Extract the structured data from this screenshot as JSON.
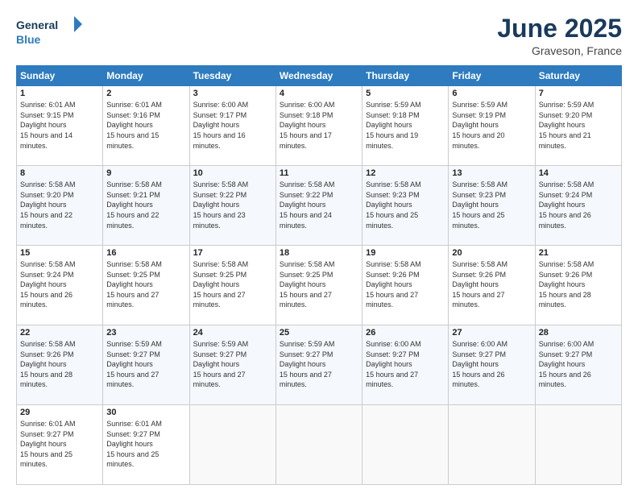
{
  "header": {
    "logo_general": "General",
    "logo_blue": "Blue",
    "month_title": "June 2025",
    "location": "Graveson, France"
  },
  "days_of_week": [
    "Sunday",
    "Monday",
    "Tuesday",
    "Wednesday",
    "Thursday",
    "Friday",
    "Saturday"
  ],
  "weeks": [
    [
      {
        "day": 1,
        "sunrise": "6:01 AM",
        "sunset": "9:15 PM",
        "daylight": "15 hours and 14 minutes."
      },
      {
        "day": 2,
        "sunrise": "6:01 AM",
        "sunset": "9:16 PM",
        "daylight": "15 hours and 15 minutes."
      },
      {
        "day": 3,
        "sunrise": "6:00 AM",
        "sunset": "9:17 PM",
        "daylight": "15 hours and 16 minutes."
      },
      {
        "day": 4,
        "sunrise": "6:00 AM",
        "sunset": "9:18 PM",
        "daylight": "15 hours and 17 minutes."
      },
      {
        "day": 5,
        "sunrise": "5:59 AM",
        "sunset": "9:18 PM",
        "daylight": "15 hours and 19 minutes."
      },
      {
        "day": 6,
        "sunrise": "5:59 AM",
        "sunset": "9:19 PM",
        "daylight": "15 hours and 20 minutes."
      },
      {
        "day": 7,
        "sunrise": "5:59 AM",
        "sunset": "9:20 PM",
        "daylight": "15 hours and 21 minutes."
      }
    ],
    [
      {
        "day": 8,
        "sunrise": "5:58 AM",
        "sunset": "9:20 PM",
        "daylight": "15 hours and 22 minutes."
      },
      {
        "day": 9,
        "sunrise": "5:58 AM",
        "sunset": "9:21 PM",
        "daylight": "15 hours and 22 minutes."
      },
      {
        "day": 10,
        "sunrise": "5:58 AM",
        "sunset": "9:22 PM",
        "daylight": "15 hours and 23 minutes."
      },
      {
        "day": 11,
        "sunrise": "5:58 AM",
        "sunset": "9:22 PM",
        "daylight": "15 hours and 24 minutes."
      },
      {
        "day": 12,
        "sunrise": "5:58 AM",
        "sunset": "9:23 PM",
        "daylight": "15 hours and 25 minutes."
      },
      {
        "day": 13,
        "sunrise": "5:58 AM",
        "sunset": "9:23 PM",
        "daylight": "15 hours and 25 minutes."
      },
      {
        "day": 14,
        "sunrise": "5:58 AM",
        "sunset": "9:24 PM",
        "daylight": "15 hours and 26 minutes."
      }
    ],
    [
      {
        "day": 15,
        "sunrise": "5:58 AM",
        "sunset": "9:24 PM",
        "daylight": "15 hours and 26 minutes."
      },
      {
        "day": 16,
        "sunrise": "5:58 AM",
        "sunset": "9:25 PM",
        "daylight": "15 hours and 27 minutes."
      },
      {
        "day": 17,
        "sunrise": "5:58 AM",
        "sunset": "9:25 PM",
        "daylight": "15 hours and 27 minutes."
      },
      {
        "day": 18,
        "sunrise": "5:58 AM",
        "sunset": "9:25 PM",
        "daylight": "15 hours and 27 minutes."
      },
      {
        "day": 19,
        "sunrise": "5:58 AM",
        "sunset": "9:26 PM",
        "daylight": "15 hours and 27 minutes."
      },
      {
        "day": 20,
        "sunrise": "5:58 AM",
        "sunset": "9:26 PM",
        "daylight": "15 hours and 27 minutes."
      },
      {
        "day": 21,
        "sunrise": "5:58 AM",
        "sunset": "9:26 PM",
        "daylight": "15 hours and 28 minutes."
      }
    ],
    [
      {
        "day": 22,
        "sunrise": "5:58 AM",
        "sunset": "9:26 PM",
        "daylight": "15 hours and 28 minutes."
      },
      {
        "day": 23,
        "sunrise": "5:59 AM",
        "sunset": "9:27 PM",
        "daylight": "15 hours and 27 minutes."
      },
      {
        "day": 24,
        "sunrise": "5:59 AM",
        "sunset": "9:27 PM",
        "daylight": "15 hours and 27 minutes."
      },
      {
        "day": 25,
        "sunrise": "5:59 AM",
        "sunset": "9:27 PM",
        "daylight": "15 hours and 27 minutes."
      },
      {
        "day": 26,
        "sunrise": "6:00 AM",
        "sunset": "9:27 PM",
        "daylight": "15 hours and 27 minutes."
      },
      {
        "day": 27,
        "sunrise": "6:00 AM",
        "sunset": "9:27 PM",
        "daylight": "15 hours and 26 minutes."
      },
      {
        "day": 28,
        "sunrise": "6:00 AM",
        "sunset": "9:27 PM",
        "daylight": "15 hours and 26 minutes."
      }
    ],
    [
      {
        "day": 29,
        "sunrise": "6:01 AM",
        "sunset": "9:27 PM",
        "daylight": "15 hours and 25 minutes."
      },
      {
        "day": 30,
        "sunrise": "6:01 AM",
        "sunset": "9:27 PM",
        "daylight": "15 hours and 25 minutes."
      },
      null,
      null,
      null,
      null,
      null
    ]
  ]
}
